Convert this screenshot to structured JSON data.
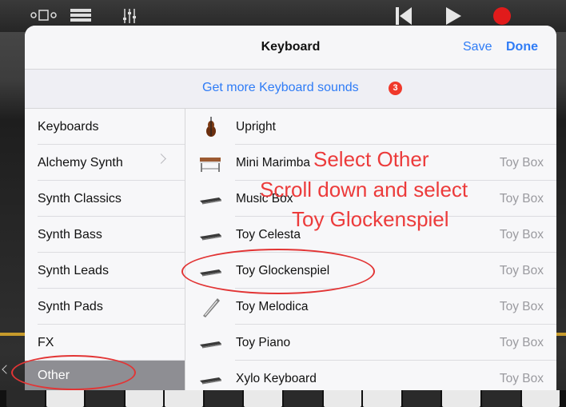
{
  "toolbar": {
    "icons": [
      "view-toggle-icon",
      "tracks-icon",
      "mixer-icon",
      "rewind-icon",
      "play-icon",
      "record-icon"
    ],
    "record_color": "#e11b1b"
  },
  "popover": {
    "title": "Keyboard",
    "save_label": "Save",
    "done_label": "Done",
    "banner_text": "Get more Keyboard sounds",
    "badge_count": "3",
    "accent_color": "#2f7cf6"
  },
  "categories": [
    {
      "label": "Keyboards"
    },
    {
      "label": "Alchemy Synth",
      "has_submenu": true
    },
    {
      "label": "Synth Classics"
    },
    {
      "label": "Synth Bass"
    },
    {
      "label": "Synth Leads"
    },
    {
      "label": "Synth Pads"
    },
    {
      "label": "FX"
    },
    {
      "label": "Other",
      "selected": true
    }
  ],
  "sounds": [
    {
      "name": "Upright",
      "group": "",
      "icon": "upright-bass-icon"
    },
    {
      "name": "Mini Marimba",
      "group": "Toy Box",
      "icon": "marimba-icon"
    },
    {
      "name": "Music Box",
      "group": "Toy Box",
      "icon": "keyboard-icon"
    },
    {
      "name": "Toy Celesta",
      "group": "Toy Box",
      "icon": "keyboard-icon"
    },
    {
      "name": "Toy Glockenspiel",
      "group": "Toy Box",
      "icon": "keyboard-icon"
    },
    {
      "name": "Toy Melodica",
      "group": "Toy Box",
      "icon": "melodica-icon"
    },
    {
      "name": "Toy Piano",
      "group": "Toy Box",
      "icon": "keyboard-icon"
    },
    {
      "name": "Xylo Keyboard",
      "group": "Toy Box",
      "icon": "keyboard-icon"
    }
  ],
  "annotation": {
    "line1": "Select Other",
    "line2": "Scroll down and select",
    "line3": "Toy Glockenspiel",
    "color": "#ec3b3b"
  }
}
